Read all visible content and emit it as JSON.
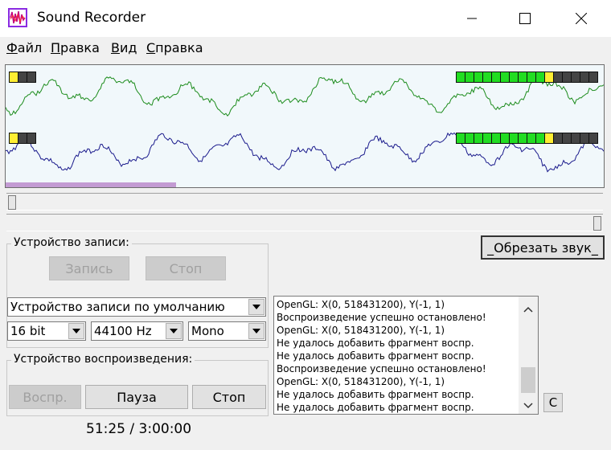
{
  "window": {
    "title": "Sound Recorder"
  },
  "menu": [
    {
      "key": "Ф",
      "rest": "айл"
    },
    {
      "key": "П",
      "rest": "равка"
    },
    {
      "key": "В",
      "rest": "ид"
    },
    {
      "key": "С",
      "rest": "правка"
    }
  ],
  "levels": {
    "left_in_segments": 3,
    "left_in_lit": 1,
    "right_in_segments": 3,
    "right_in_lit": 1,
    "left_out_segments": 16,
    "left_out_lit": 11,
    "right_out_segments": 16,
    "right_out_lit": 11,
    "colors": {
      "green": "#22dd22",
      "yellow": "#ffee33",
      "off": "#444444"
    }
  },
  "waveform": {
    "channel_colors": [
      "#1c8c1c",
      "#1a1a8c"
    ],
    "background": "#f1f8fb",
    "progress_color": "#c39bd3",
    "progress_fraction": 0.285
  },
  "position_slider": {
    "fraction": 0.0
  },
  "volume_slider": {
    "fraction": 1.0
  },
  "trim_button": {
    "label": "_Обрезать звук_"
  },
  "record_group": {
    "label": "Устройство записи:",
    "record_button": "Запись",
    "stop_button": "Стоп",
    "device": "Устройство записи по умолчанию",
    "bits": "16 bit",
    "rate": "44100 Hz",
    "channels": "Mono"
  },
  "playback_group": {
    "label": "Устройство воспроизведения:",
    "play_button": "Воспр.",
    "pause_button": "Пауза",
    "stop_button": "Стоп"
  },
  "log": {
    "lines": [
      "OpenGL: X(0, 518431200), Y(-1, 1)",
      "Воспроизведение успешно остановлено!",
      "OpenGL: X(0, 518431200), Y(-1, 1)",
      "Не удалось добавить фрагмент воспр.",
      "Не удалось добавить фрагмент воспр.",
      "Воспроизведение успешно остановлено!",
      "OpenGL: X(0, 518431200), Y(-1, 1)",
      "Не удалось добавить фрагмент воспр.",
      "Не удалось добавить фрагмент воспр."
    ],
    "clear_button": "C"
  },
  "time": "51:25 / 3:00:00"
}
